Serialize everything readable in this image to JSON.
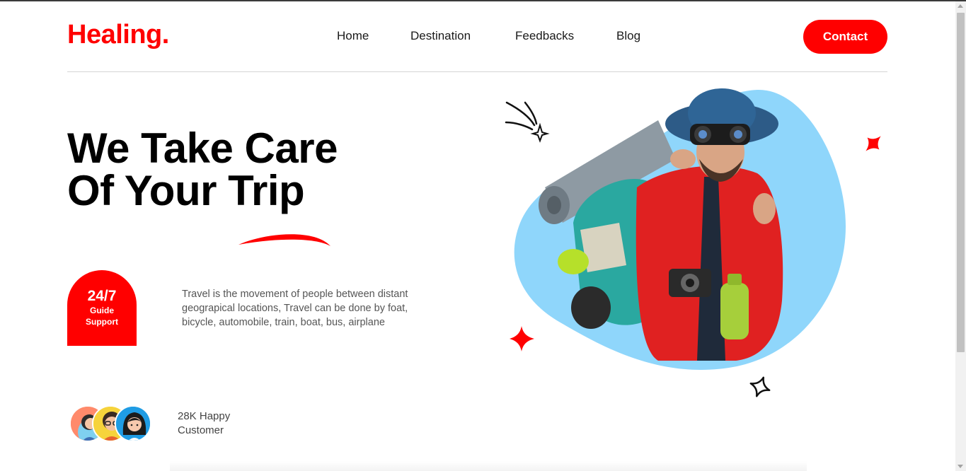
{
  "brand": {
    "logo": "Healing."
  },
  "nav": {
    "items": [
      {
        "label": "Home"
      },
      {
        "label": "Destination"
      },
      {
        "label": "Feedbacks"
      },
      {
        "label": "Blog"
      }
    ],
    "contact_label": "Contact"
  },
  "hero": {
    "headline_line1": "We Take Care",
    "headline_line2": "Of Your Trip",
    "support": {
      "big": "24/7",
      "line1": "Guide",
      "line2": "Support"
    },
    "description": "Travel is the movement of people between distant geograpical locations, Travel can be done by foat, bicycle, automobile, train, boat, bus, airplane",
    "customers_line1": "28K Happy",
    "customers_line2": "Customer"
  },
  "colors": {
    "accent": "#ff0000",
    "blob": "#8fd6fb",
    "text": "#000000"
  },
  "icons": [
    "sparkle-icon",
    "shooting-star-icon",
    "avatar-icon"
  ]
}
